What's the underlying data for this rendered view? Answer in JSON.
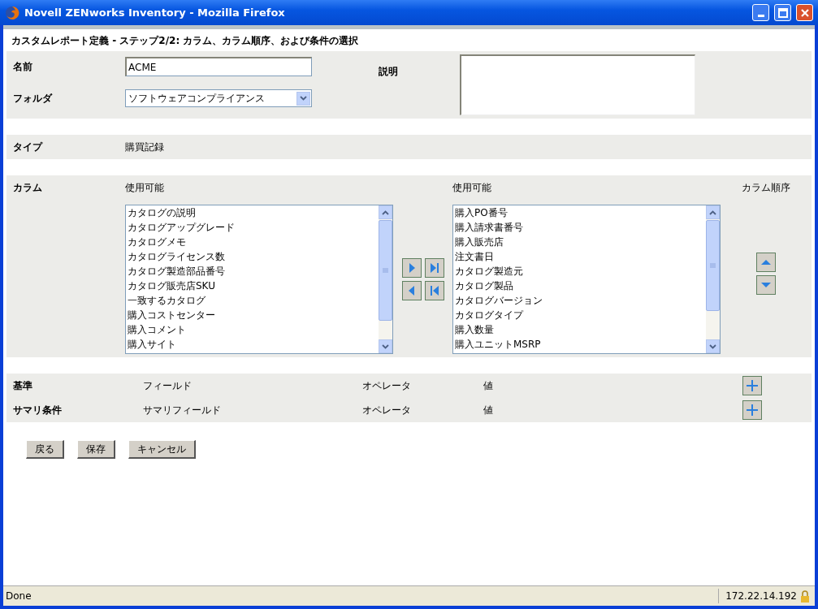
{
  "window": {
    "title": "Novell ZENworks Inventory - Mozilla Firefox"
  },
  "form": {
    "heading": "カスタムレポート定義 - ステップ2/2: カラム、カラム順序、および条件の選択",
    "name": {
      "label": "名前",
      "value": "ACME"
    },
    "description": {
      "label": "説明"
    },
    "folder": {
      "label": "フォルダ",
      "value": "ソフトウェアコンプライアンス"
    },
    "type": {
      "label": "タイプ",
      "value": "購買記録"
    },
    "columns": {
      "label": "カラム",
      "available": {
        "heading": "使用可能",
        "items": [
          "カタログの説明",
          "カタログアップグレード",
          "カタログメモ",
          "カタログライセンス数",
          "カタログ製造部品番号",
          "カタログ販売店SKU",
          "一致するカタログ",
          "購入コストセンター",
          "購入コメント",
          "購入サイト"
        ]
      },
      "selected": {
        "heading": "使用可能",
        "items": [
          "購入PO番号",
          "購入請求書番号",
          "購入販売店",
          "注文書日",
          "カタログ製造元",
          "カタログ製品",
          "カタログバージョン",
          "カタログタイプ",
          "購入数量",
          "購入ユニットMSRP"
        ]
      },
      "order_heading": "カラム順序"
    },
    "criteria": [
      {
        "label": "基準",
        "field": "フィールド",
        "operator": "オペレータ",
        "value": "値"
      },
      {
        "label": "サマリ条件",
        "field": "サマリフィールド",
        "operator": "オペレータ",
        "value": "値"
      }
    ],
    "buttons": [
      "戻る",
      "保存",
      "キャンセル"
    ]
  },
  "status_bar": {
    "text": "Done",
    "address": "172.22.14.192"
  }
}
